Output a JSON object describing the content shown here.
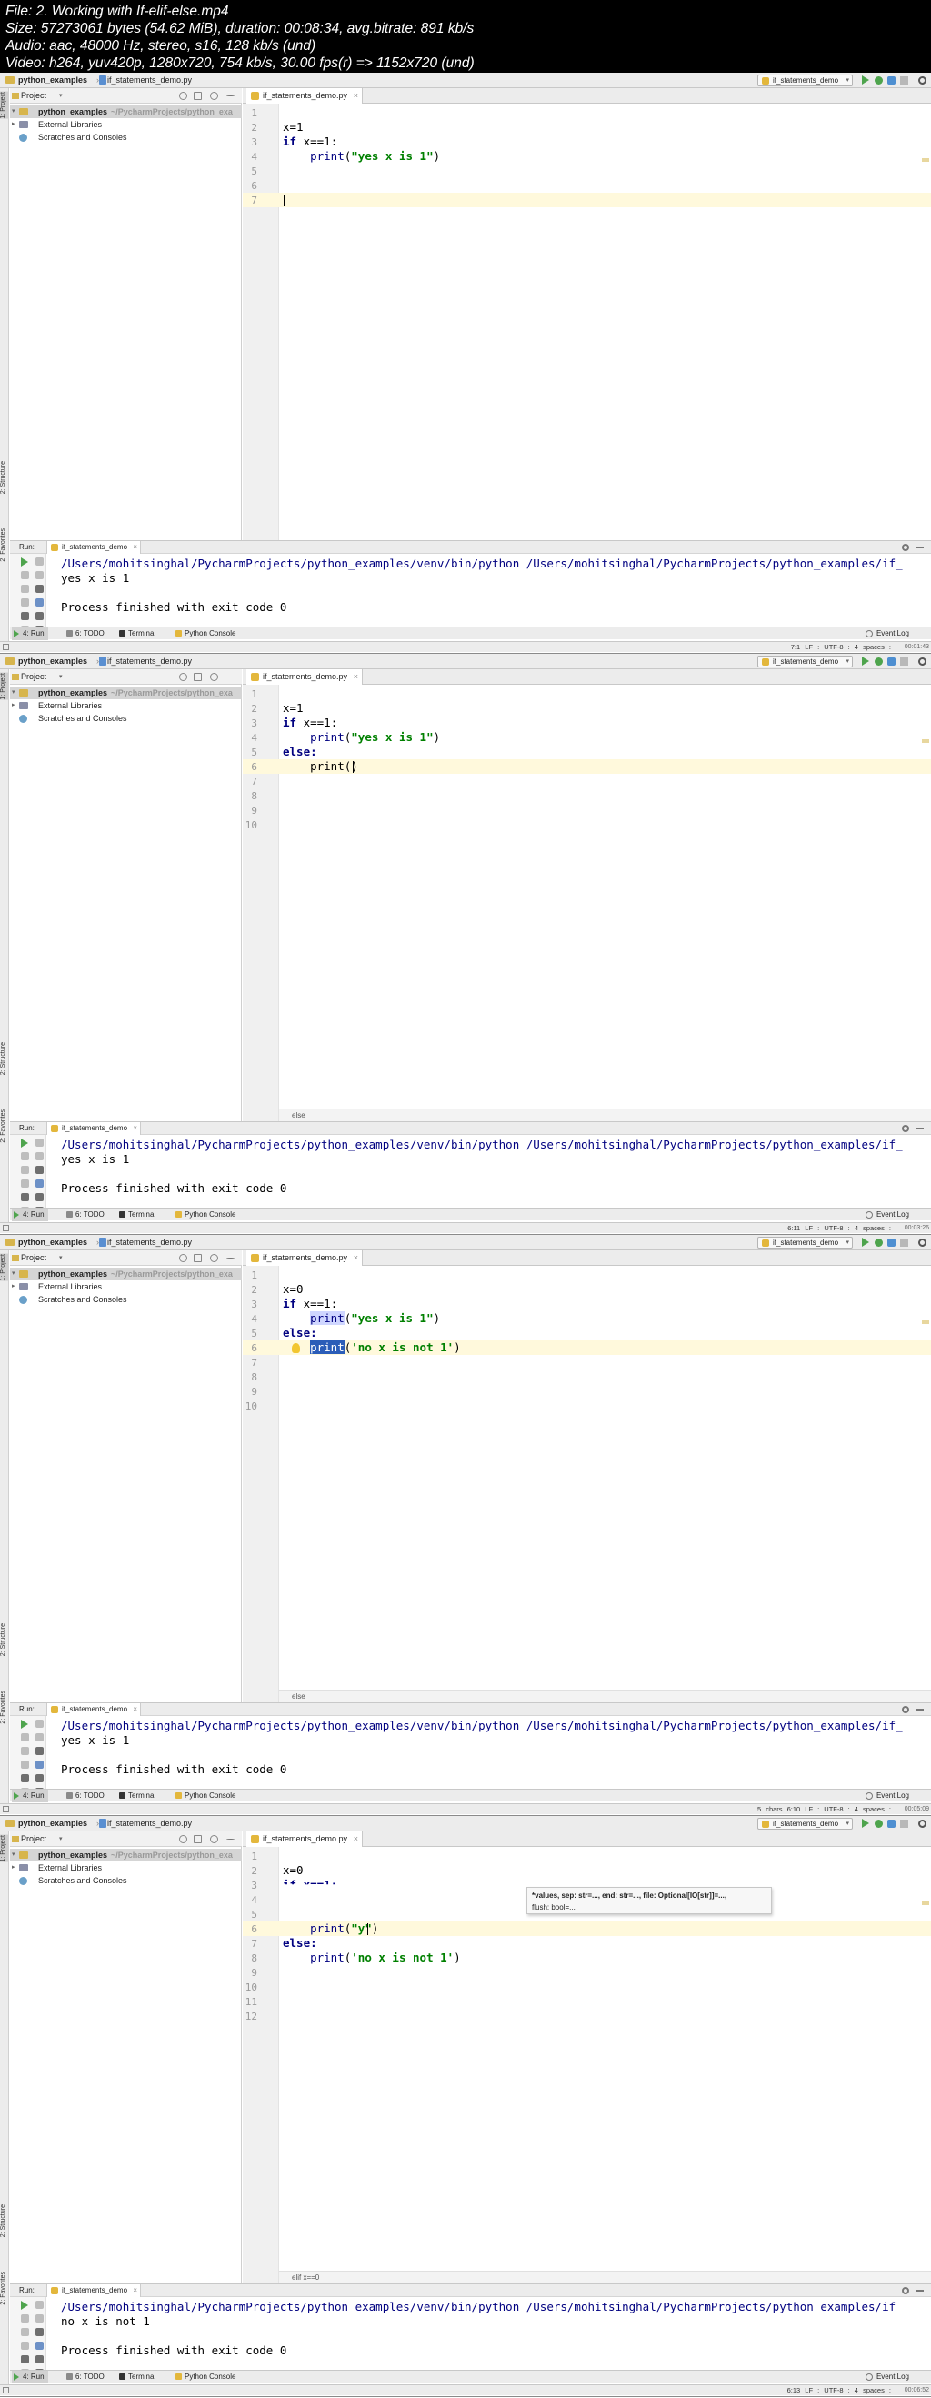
{
  "header": {
    "file": "File: 2. Working with If-elif-else.mp4",
    "size": "Size: 57273061 bytes (54.62 MiB), duration: 00:08:34, avg.bitrate: 891 kb/s",
    "audio": "Audio: aac, 48000 Hz, stereo, s16, 128 kb/s (und)",
    "video": "Video: h264, yuv420p, 1280x720, 754 kb/s, 30.00 fps(r) => 1152x720 (und)"
  },
  "ide": {
    "project_name": "python_examples",
    "file_name": "if_statements_demo.py",
    "run_config": "if_statements_demo",
    "project_label": "Project",
    "project_path": "~/PycharmProjects/python_exa",
    "tree": [
      "python_examples",
      "External Libraries",
      "Scratches and Consoles"
    ],
    "run_label": "Run:",
    "left_stripe": [
      "1: Project",
      "2: Structure",
      "2: Favorites"
    ],
    "bottom_tabs": [
      "4: Run",
      "6: TODO",
      "Terminal",
      "Python Console"
    ],
    "event_log": "Event Log",
    "run_cmd": "/Users/mohitsinghal/PycharmProjects/python_examples/venv/bin/python /Users/mohitsinghal/PycharmProjects/python_examples/if_",
    "exit_msg": "Process finished with exit code 0"
  },
  "frames": [
    {
      "line_numbers": [
        "1",
        "2",
        "3",
        "4",
        "5",
        "6",
        "7"
      ],
      "output": "yes x is 1",
      "status": "7:1  LF :  UTF-8 :  4 spaces :",
      "stamp": "00:01:43",
      "breadcrumb": ""
    },
    {
      "line_numbers": [
        "1",
        "2",
        "3",
        "4",
        "5",
        "6",
        "7",
        "8",
        "9",
        "10"
      ],
      "output": "yes x is 1",
      "status": "6:11  LF :  UTF-8 :  4 spaces :",
      "stamp": "00:03:26",
      "breadcrumb": "else"
    },
    {
      "line_numbers": [
        "1",
        "2",
        "3",
        "4",
        "5",
        "6",
        "7",
        "8",
        "9",
        "10"
      ],
      "output": "yes x is 1",
      "status": "5 chars   6:10  LF :  UTF-8 :  4 spaces :",
      "stamp": "00:05:09",
      "breadcrumb": "else"
    },
    {
      "line_numbers": [
        "1",
        "2",
        "3",
        "4",
        "5",
        "6",
        "7",
        "8",
        "9",
        "10",
        "11",
        "12"
      ],
      "output": "no x is not 1",
      "status": "6:13  LF :  UTF-8 :  4 spaces :",
      "stamp": "00:06:52",
      "breadcrumb": "elif x==0",
      "tooltip_1": "*values, sep: str=..., end: str=..., file: Optional[IO[str]]=...,",
      "tooltip_2": "flush: bool=..."
    }
  ],
  "code": {
    "f1": {
      "l2": "x=1",
      "l3_kw": "if",
      "l3_rest": " x==1:",
      "l4_fn": "print",
      "l4_str": "\"yes x is 1\""
    },
    "f2": {
      "l2": "x=1",
      "l3_kw": "if",
      "l3_rest": " x==1:",
      "l4_fn": "print",
      "l4_str": "\"yes x is 1\"",
      "l5": "else:",
      "l6": "print()"
    },
    "f3": {
      "l2": "x=0",
      "l3_kw": "if",
      "l3_rest": " x==1:",
      "l4_fn": "print",
      "l4_str": "\"yes x is 1\"",
      "l5": "else:",
      "l6_fn": "print",
      "l6_str": "'no x is not 1'"
    },
    "f4": {
      "l2": "x=0",
      "l3_partial": "if x==1:",
      "l6_fn": "print",
      "l6_str": "\"y\"",
      "l7": "else:",
      "l8_fn": "print",
      "l8_str": "'no x is not 1'"
    }
  },
  "colors": {
    "keyword": "#000080",
    "string": "#008000",
    "caret_line": "#fff9dc",
    "selection": "#2b5db8"
  }
}
